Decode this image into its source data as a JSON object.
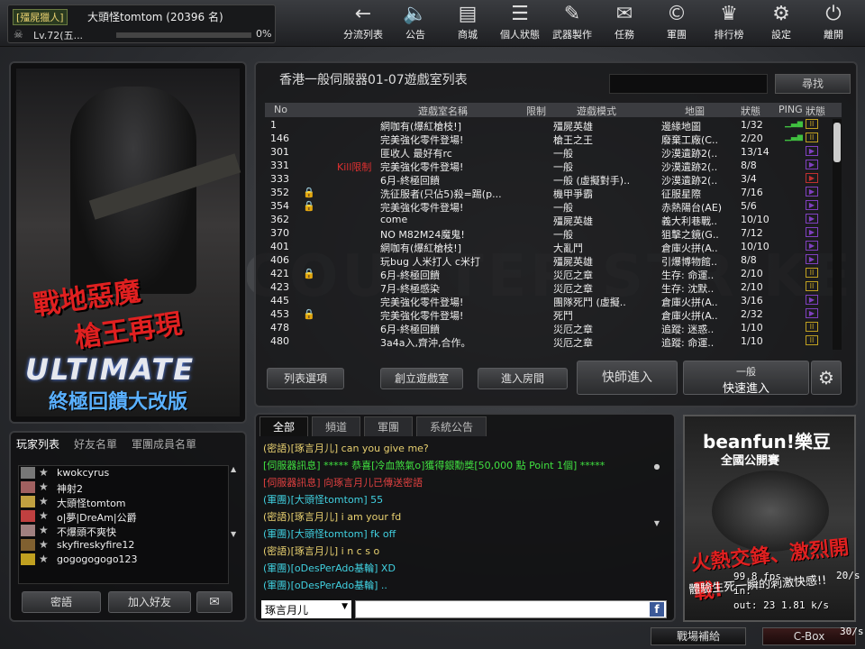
{
  "player": {
    "rank_badge": "[殭屍獵人]",
    "name": "大頭怪tomtom (20396 名)",
    "level": "Lv.72(五...",
    "exp_pct": "0%",
    "exp_fill": 0.0
  },
  "nav": [
    {
      "label": "分流列表",
      "icon": "←"
    },
    {
      "label": "公告",
      "icon": "🔈"
    },
    {
      "label": "商城",
      "icon": "▤"
    },
    {
      "label": "個人狀態",
      "icon": "☰"
    },
    {
      "label": "武器製作",
      "icon": "✎"
    },
    {
      "label": "任務",
      "icon": "✉"
    },
    {
      "label": "軍團",
      "icon": "©"
    },
    {
      "label": "排行榜",
      "icon": "♛"
    },
    {
      "label": "設定",
      "icon": "⚙"
    },
    {
      "label": "離開",
      "icon": "⏻"
    }
  ],
  "poster": {
    "slogan1": "戰地惡魔",
    "slogan2": "槍王再現",
    "title": "ULTIMATE",
    "subtitle": "終極回饋大改版"
  },
  "room_list": {
    "server_title": "香港一般伺服器01-07遊戲室列表",
    "search_label": "尋找",
    "headers": {
      "no": "No",
      "name": "遊戲室名稱",
      "limit": "限制",
      "mode": "遊戲模式",
      "map": "地圖",
      "status": "狀態",
      "ping": "PING",
      "state": "狀態"
    },
    "rows": [
      {
        "no": "1",
        "lock": "",
        "limit": "",
        "name": "網咖有(爆紅槍枝!]",
        "mode": "殭屍英雄",
        "map": "邊緣地圖",
        "status": "1/32",
        "ping": "▁▃▅",
        "state": "II",
        "state_color": "#c0a020"
      },
      {
        "no": "146",
        "lock": "",
        "limit": "",
        "name": "完美強化零件登場!",
        "mode": "槍王之王",
        "map": "廢棄工廠(C..",
        "status": "2/20",
        "ping": "▁▃▅",
        "state": "II",
        "state_color": "#c0a020"
      },
      {
        "no": "301",
        "lock": "",
        "limit": "",
        "name": "匪收人 最好有rc",
        "mode": "一般",
        "map": "沙漠遺跡2(..",
        "status": "13/14",
        "ping": "",
        "state": "▶",
        "state_color": "#8040c0"
      },
      {
        "no": "331",
        "lock": "",
        "limit": "Kill限制",
        "name": "完美強化零件登場!",
        "mode": "一般",
        "map": "沙漠遺跡2(..",
        "status": "8/8",
        "ping": "",
        "state": "▶",
        "state_color": "#8040c0"
      },
      {
        "no": "333",
        "lock": "",
        "limit": "",
        "name": "6月-終極回饋",
        "mode": "一般 (虛擬對手)..",
        "map": "沙漠遺跡2(..",
        "status": "3/4",
        "ping": "",
        "state": "▶",
        "state_color": "#c03030"
      },
      {
        "no": "352",
        "lock": "🔒",
        "limit": "",
        "name": "洗征服者(只佔5)殺=踢(p...",
        "mode": "機甲爭霸",
        "map": "征服星際",
        "status": "7/16",
        "ping": "",
        "state": "▶",
        "state_color": "#8040c0"
      },
      {
        "no": "354",
        "lock": "🔒",
        "limit": "",
        "name": "完美強化零件登場!",
        "mode": "一般",
        "map": "赤熱陽台(AE)",
        "status": "5/6",
        "ping": "",
        "state": "▶",
        "state_color": "#8040c0"
      },
      {
        "no": "362",
        "lock": "",
        "limit": "",
        "name": "come",
        "mode": "殭屍英雄",
        "map": "義大利巷戰..",
        "status": "10/10",
        "ping": "",
        "state": "▶",
        "state_color": "#8040c0"
      },
      {
        "no": "370",
        "lock": "",
        "limit": "",
        "name": "NO M82M24魔鬼!",
        "mode": "一般",
        "map": "狙擊之鏡(G..",
        "status": "7/12",
        "ping": "",
        "state": "▶",
        "state_color": "#8040c0"
      },
      {
        "no": "401",
        "lock": "",
        "limit": "",
        "name": "網咖有(爆紅槍枝!]",
        "mode": "大亂鬥",
        "map": "倉庫火拼(A..",
        "status": "10/10",
        "ping": "",
        "state": "▶",
        "state_color": "#8040c0"
      },
      {
        "no": "406",
        "lock": "",
        "limit": "",
        "name": "玩bug 人米打人 c米打",
        "mode": "殭屍英雄",
        "map": "引爆博物館..",
        "status": "8/8",
        "ping": "",
        "state": "▶",
        "state_color": "#8040c0"
      },
      {
        "no": "421",
        "lock": "🔒",
        "limit": "",
        "name": "6月-終極回饋",
        "mode": "災厄之章",
        "map": "生存: 命運..",
        "status": "2/10",
        "ping": "",
        "state": "II",
        "state_color": "#c0a020"
      },
      {
        "no": "423",
        "lock": "",
        "limit": "",
        "name": "7月-終極感染",
        "mode": "災厄之章",
        "map": "生存: 沈默..",
        "status": "2/10",
        "ping": "",
        "state": "II",
        "state_color": "#c0a020"
      },
      {
        "no": "445",
        "lock": "",
        "limit": "",
        "name": "完美強化零件登場!",
        "mode": "團隊死鬥 (虛擬..",
        "map": "倉庫火拼(A..",
        "status": "3/16",
        "ping": "",
        "state": "▶",
        "state_color": "#8040c0"
      },
      {
        "no": "453",
        "lock": "🔒",
        "limit": "",
        "name": "完美強化零件登場!",
        "mode": "死鬥",
        "map": "倉庫火拼(A..",
        "status": "2/32",
        "ping": "",
        "state": "▶",
        "state_color": "#8040c0"
      },
      {
        "no": "478",
        "lock": "",
        "limit": "",
        "name": "6月-終極回饋",
        "mode": "災厄之章",
        "map": "追蹤: 迷惑..",
        "status": "1/10",
        "ping": "",
        "state": "II",
        "state_color": "#c0a020"
      },
      {
        "no": "480",
        "lock": "",
        "limit": "",
        "name": "3a4a入,齊沖,合作。",
        "mode": "災厄之章",
        "map": "追蹤: 命運..",
        "status": "1/10",
        "ping": "",
        "state": "II",
        "state_color": "#c0a020"
      }
    ],
    "buttons": {
      "list_options": "列表選項",
      "create_room": "創立遊戲室",
      "enter_room": "進入房間",
      "master_enter": "快師進入",
      "quick_mode": "一般",
      "quick_enter": "快速進入"
    }
  },
  "friends": {
    "tabs": [
      "玩家列表",
      "好友名單",
      "軍團成員名單"
    ],
    "items": [
      {
        "name": "kwokcyrus"
      },
      {
        "name": "神射2"
      },
      {
        "name": "大頭怪tomtom"
      },
      {
        "name": "o|夢|DreAm|公爵"
      },
      {
        "name": "不爆頭不爽快"
      },
      {
        "name": "skyfireskyfire12"
      },
      {
        "name": "gogogogogo123"
      }
    ],
    "whisper_btn": "密語",
    "add_friend_btn": "加入好友"
  },
  "chat": {
    "tabs": [
      "全部",
      "頻道",
      "軍團",
      "系統公告"
    ],
    "lines": [
      {
        "text": "(密語)[琢言月儿] can you give me?",
        "color": "#e8d070"
      },
      {
        "text": "[伺服器訊息] ***** 恭喜[冷血煞氣o]獲得銀勳獎[50,000 點 Point 1個] *****",
        "color": "#40e040"
      },
      {
        "text": "[伺服器訊息] 向琢言月儿已傳送密語",
        "color": "#e04040"
      },
      {
        "text": "(軍團)[大頭怪tomtom] 55",
        "color": "#40d0e0"
      },
      {
        "text": "(密語)[琢言月儿] i am your fd",
        "color": "#e8d070"
      },
      {
        "text": "(軍團)[大頭怪tomtom] fk off",
        "color": "#40d0e0"
      },
      {
        "text": "(密語)[琢言月儿] i n c s o",
        "color": "#e8d070"
      },
      {
        "text": "(軍團)[oDesPerAdo基輪] XD",
        "color": "#40d0e0"
      },
      {
        "text": "(軍團)[oDesPerAdo基輪] ..",
        "color": "#40d0e0"
      }
    ],
    "target": "琢言月儿"
  },
  "ad": {
    "brand": "beanfun!樂豆",
    "subtitle": "全國公開賽",
    "slogan": "火熱交鋒、激烈開戰!",
    "slogan2": "體驗生死一瞬的刺激快感!!"
  },
  "fps": {
    "line1": "99.8 fps",
    "line2": "in:  ¯",
    "line3": "out:  23 1.81 k/s",
    "side": "20/s"
  },
  "bottom": {
    "supply": "戰場補給",
    "cbox": "C-Box",
    "rate": "30/s"
  }
}
